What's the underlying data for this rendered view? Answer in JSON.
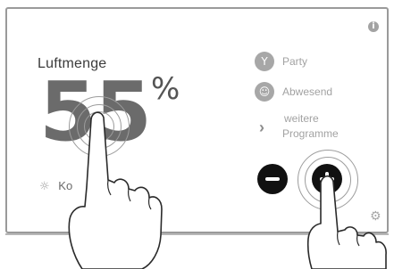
{
  "screen": {
    "title": "Luftmenge",
    "value": "55",
    "unit": "%",
    "mode_label": "Ko"
  },
  "programs": {
    "party": "Party",
    "away": "Abwesend",
    "more_line1": "weitere",
    "more_line2": "Programme"
  },
  "icons": {
    "info": "i",
    "sun": "☼",
    "chevron": "›",
    "party_icon": "🍸",
    "away_icon": "👤",
    "gear": "⚙"
  }
}
